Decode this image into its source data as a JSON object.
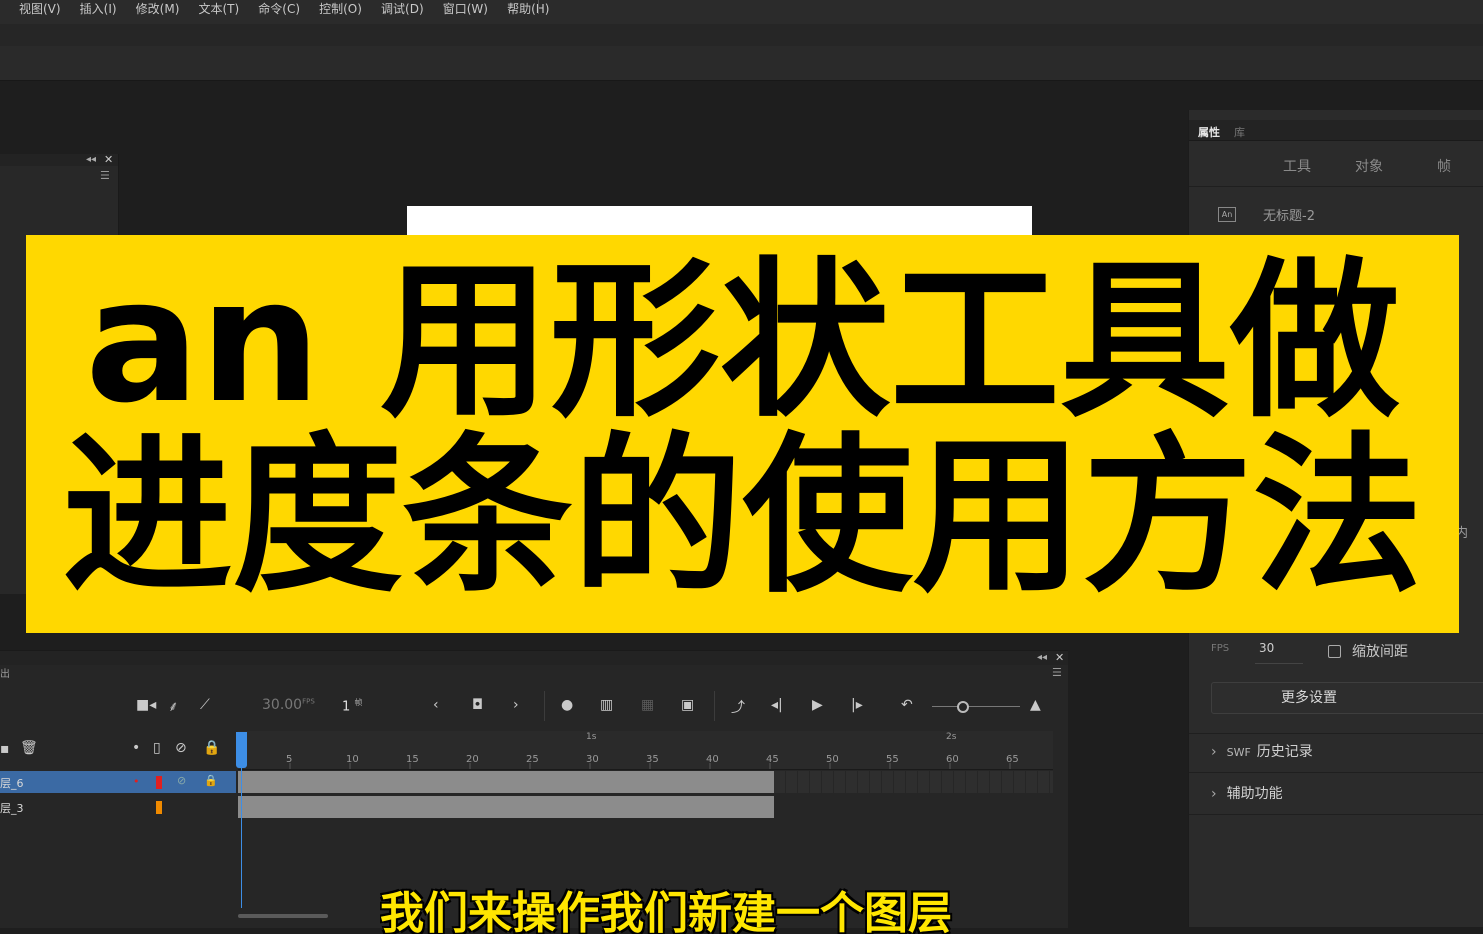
{
  "menu": [
    "视图(V)",
    "插入(I)",
    "修改(M)",
    "文本(T)",
    "命令(C)",
    "控制(O)",
    "调试(D)",
    "窗口(W)",
    "帮助(H)"
  ],
  "properties": {
    "tabs": [
      "属性",
      "库"
    ],
    "subtabs": [
      "工具",
      "对象",
      "帧"
    ],
    "doc_icon": "An",
    "doc_name": "无标题-2",
    "fps_label": "FPS",
    "fps_value": "30",
    "scale_spacing_label": "缩放间距",
    "more_settings": "更多设置",
    "sections": {
      "swf": "SWF",
      "history": "历史记录",
      "accessibility": "辅助功能"
    },
    "cut_text": "内"
  },
  "timeline": {
    "panel_label": "出",
    "fps_readout": "30.00",
    "fps_unit": "FPS",
    "frame_readout": "1",
    "frame_unit": "帧",
    "frame_numbers": [
      "5",
      "10",
      "15",
      "20",
      "25",
      "30",
      "35",
      "40",
      "45",
      "50",
      "55",
      "60",
      "65"
    ],
    "seconds": [
      "1s",
      "2s"
    ],
    "layers": [
      {
        "name": "层_6",
        "selected": true
      },
      {
        "name": "层_3",
        "selected": false
      }
    ]
  },
  "banner": {
    "line1": "an 用形状工具做",
    "line2": "进度条的使用方法"
  },
  "subtitle": "我们来操作我们新建一个图层"
}
